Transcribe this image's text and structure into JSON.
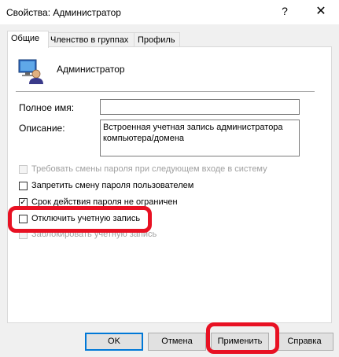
{
  "window": {
    "title": "Свойства: Администратор",
    "help": "?",
    "close": "✕"
  },
  "tabs": [
    {
      "label": "Общие",
      "active": true
    },
    {
      "label": "Членство в группах",
      "active": false
    },
    {
      "label": "Профиль",
      "active": false
    }
  ],
  "general": {
    "user_name": "Администратор",
    "full_name_label": "Полное имя:",
    "full_name_value": "",
    "description_label": "Описание:",
    "description_value": "Встроенная учетная запись администратора компьютера/домена"
  },
  "options": [
    {
      "label": "Требовать смены пароля при следующем входе в систему",
      "checked": false,
      "enabled": false
    },
    {
      "label": "Запретить смену пароля пользователем",
      "checked": false,
      "enabled": true
    },
    {
      "label": "Срок действия пароля не ограничен",
      "checked": true,
      "enabled": true
    },
    {
      "label": "Отключить учетную запись",
      "checked": false,
      "enabled": true,
      "highlighted": true
    },
    {
      "label": "Заблокировать учетную запись",
      "checked": false,
      "enabled": false
    }
  ],
  "buttons": {
    "ok": "OK",
    "cancel": "Отмена",
    "apply": "Применить",
    "help": "Справка"
  },
  "colors": {
    "highlight": "#e81123",
    "default_button_border": "#0078d7"
  }
}
